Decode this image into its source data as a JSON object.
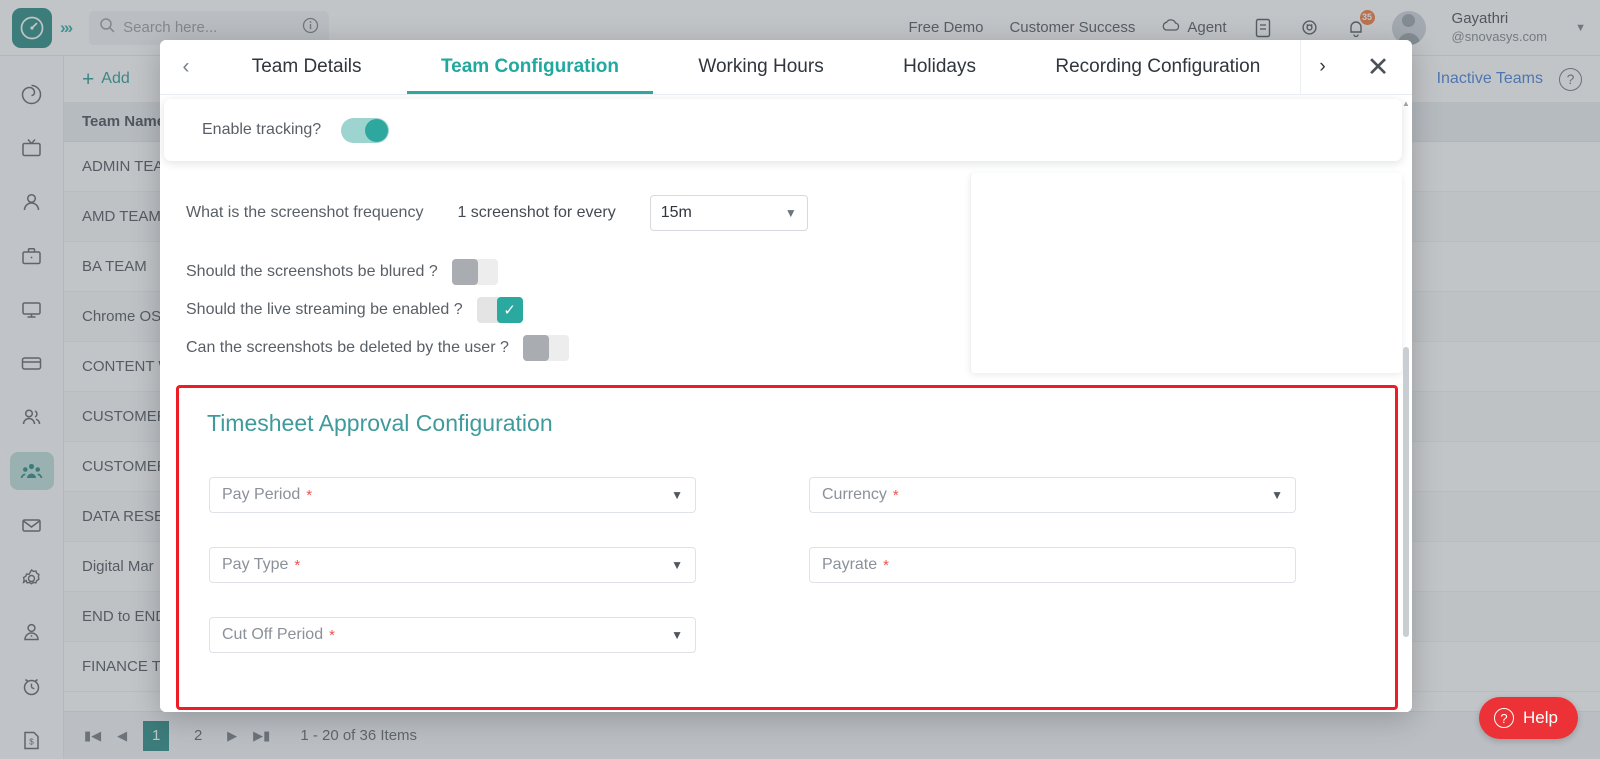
{
  "topbar": {
    "logo_icon": "clock-logo-icon",
    "expand_icon": "chevrons-right-icon",
    "search": {
      "placeholder": "Search here...",
      "value": "",
      "icon": "search-icon",
      "info_icon": "info-circle-icon"
    },
    "links": [
      "Free Demo",
      "Customer Success"
    ],
    "agent_label": "Agent",
    "agent_icon": "cloud-icon",
    "icons": [
      {
        "name": "document-icon"
      },
      {
        "name": "settings-gear-icon"
      },
      {
        "name": "notification-bell-icon",
        "badge": "35"
      }
    ],
    "user": {
      "name": "Gayathri",
      "email": "@snovasys.com",
      "avatar_icon": "user-avatar-icon",
      "caret_icon": "chevron-down-icon"
    }
  },
  "sidebar": {
    "items": [
      {
        "name": "dashboard-spiral-icon",
        "label": "Dashboard",
        "active": false
      },
      {
        "name": "tv-icon",
        "label": "Screens",
        "active": false
      },
      {
        "name": "person-icon",
        "label": "Employees",
        "active": false
      },
      {
        "name": "briefcase-icon",
        "label": "Projects",
        "active": false
      },
      {
        "name": "monitor-icon",
        "label": "Monitoring",
        "active": false
      },
      {
        "name": "card-icon",
        "label": "Billing",
        "active": false
      },
      {
        "name": "people-icon",
        "label": "Users",
        "active": false
      },
      {
        "name": "teams-icon",
        "label": "Teams",
        "active": true
      },
      {
        "name": "mail-icon",
        "label": "Mail",
        "active": false
      },
      {
        "name": "gear-icon",
        "label": "Settings",
        "active": false
      },
      {
        "name": "person-badge-icon",
        "label": "Profile",
        "active": false
      },
      {
        "name": "alarm-clock-icon",
        "label": "Timesheets",
        "active": false
      },
      {
        "name": "invoice-dollar-icon",
        "label": "Invoices",
        "active": false
      }
    ]
  },
  "page": {
    "add_label": "Add",
    "add_icon": "plus-icon",
    "inactive_teams_label": "Inactive Teams",
    "help_circle_icon": "question-circle-icon",
    "table": {
      "column_header": "Team Name",
      "rows": [
        "ADMIN TEAM",
        "AMD TEAM",
        "BA TEAM",
        "Chrome OS",
        "CONTENT W",
        "CUSTOMER",
        "CUSTOMER",
        "DATA RESEA",
        "Digital Mar",
        "END to END",
        "FINANCE TE"
      ]
    },
    "pagination": {
      "first_icon": "page-first-icon",
      "prev_icon": "page-prev-icon",
      "next_icon": "page-next-icon",
      "last_icon": "page-last-icon",
      "pages": [
        "1",
        "2"
      ],
      "active_page": "1",
      "info": "1 - 20 of 36 Items"
    },
    "help_fab": {
      "label": "Help",
      "icon": "question-circle-icon"
    }
  },
  "modal": {
    "prev_icon": "chevron-left-icon",
    "next_icon": "chevron-right-icon",
    "close_icon": "close-icon",
    "tabs": [
      {
        "label": "Team Details",
        "active": false
      },
      {
        "label": "Team Configuration",
        "active": true
      },
      {
        "label": "Working Hours",
        "active": false
      },
      {
        "label": "Holidays",
        "active": false
      },
      {
        "label": "Recording Configuration",
        "active": false
      }
    ],
    "enable_tracking": {
      "label": "Enable tracking?",
      "state": "on"
    },
    "screenshot_frequency": {
      "label": "What is the screenshot frequency",
      "sub_label": "1 screenshot for every",
      "value": "15m",
      "arrow_icon": "chevron-down-icon"
    },
    "questions": [
      {
        "label": "Should the screenshots be blured ?",
        "state": "off",
        "style": "square"
      },
      {
        "label": "Should the live streaming be enabled ?",
        "state": "on",
        "style": "square",
        "check_icon": "check-icon"
      },
      {
        "label": "Can the screenshots be deleted by the user ?",
        "state": "off",
        "style": "square"
      }
    ],
    "timesheet": {
      "title": "Timesheet Approval Configuration",
      "highlight_color": "#ee1c24",
      "fields": [
        {
          "label": "Pay Period",
          "required": true,
          "type": "select",
          "value": "",
          "arrow_icon": "chevron-down-icon"
        },
        {
          "label": "Currency",
          "required": true,
          "type": "select",
          "value": "",
          "arrow_icon": "chevron-down-icon"
        },
        {
          "label": "Pay Type",
          "required": true,
          "type": "select",
          "value": "",
          "arrow_icon": "chevron-down-icon"
        },
        {
          "label": "Payrate",
          "required": true,
          "type": "text",
          "value": ""
        },
        {
          "label": "Cut Off Period",
          "required": true,
          "type": "select",
          "value": "",
          "arrow_icon": "chevron-down-icon"
        }
      ]
    },
    "scrollbar": {
      "name": "modal-scrollbar"
    }
  },
  "colors": {
    "teal": "#2ea79f",
    "teal_dark": "#0b7b73",
    "red": "#ee1c24",
    "link_blue": "#2f6fd0",
    "required": "#ef5350"
  }
}
